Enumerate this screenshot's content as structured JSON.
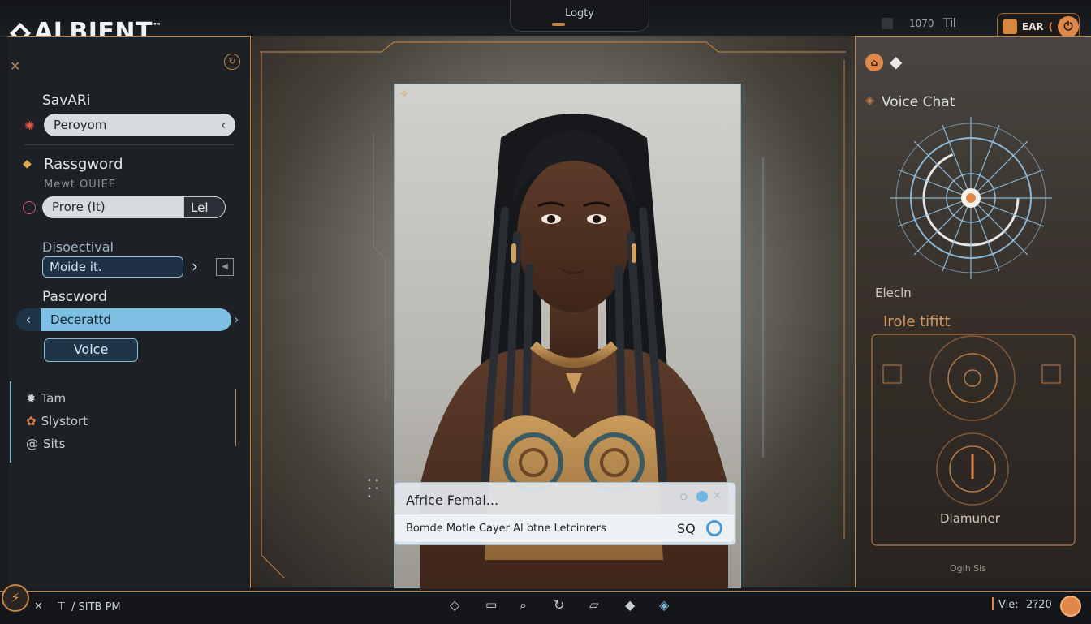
{
  "app": {
    "logo": "ALBIENT",
    "logo_mark": "™"
  },
  "topbar": {
    "center_title": "Logty",
    "stat_value": "1070",
    "stat_label": "Til",
    "ear_label": "EAR",
    "ear_symbol": "("
  },
  "left_panel": {
    "section1_label": "SavARi",
    "field1_value": "Peroyom",
    "field1_arrow": "‹",
    "section2_label": "Rassgword",
    "section2_sublabel": "Mewt OUIEE",
    "field2_value": "Prore (It)",
    "field2_button": "Lel",
    "section3_label": "Disoectival",
    "field3_value": "Moide it.",
    "section4_label": "Pascword",
    "field4_value": "Decerattd",
    "voice_button": "Voice",
    "nav": [
      {
        "label": "Tam",
        "icon": "sun-icon"
      },
      {
        "label": "Slystort",
        "icon": "paw-icon"
      },
      {
        "label": "Sits",
        "icon": "at-icon"
      }
    ]
  },
  "center": {
    "result_title": "Africe Femal...",
    "result_subtitle": "Bomde Motle Cayer Al btne Letcinrers",
    "result_code": "SQ"
  },
  "right_panel": {
    "header": "Voice Chat",
    "label1": "Elecln",
    "label2": "Irole tifitt",
    "label3": "Dlamuner",
    "footer": "Ogih  Sis"
  },
  "bottombar": {
    "left_text": "/ SITB PM",
    "right_label": "Vie:",
    "right_value": "2?20"
  },
  "colors": {
    "accent_orange": "#c3854b",
    "accent_blue": "#7dc0e3",
    "panel_dark": "#1d2024"
  }
}
